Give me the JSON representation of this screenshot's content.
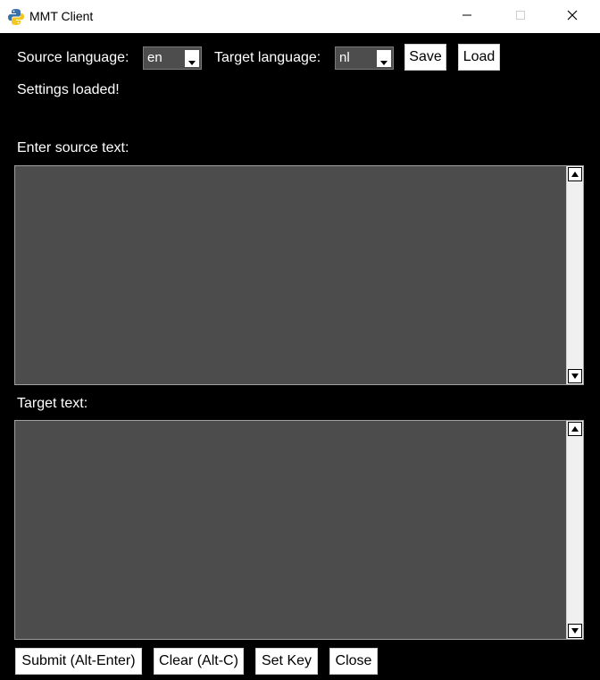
{
  "window": {
    "title": "MMT Client"
  },
  "settings": {
    "source_language_label": "Source language:",
    "source_language_value": "en",
    "target_language_label": "Target language:",
    "target_language_value": "nl",
    "save_label": "Save",
    "load_label": "Load",
    "status_text": "Settings loaded!"
  },
  "source": {
    "label": "Enter source text:",
    "text": ""
  },
  "target": {
    "label": "Target text:",
    "text": ""
  },
  "actions": {
    "submit_label": "Submit (Alt-Enter)",
    "clear_label": "Clear (Alt-C)",
    "set_key_label": "Set Key",
    "close_label": "Close"
  },
  "icons": {
    "app": "python-icon",
    "minimize": "minimize-icon",
    "maximize": "maximize-icon",
    "close": "close-icon",
    "dropdown": "dropdown-arrow-icon",
    "scroll_up": "scroll-up-arrow-icon",
    "scroll_down": "scroll-down-arrow-icon"
  },
  "colors": {
    "window_bg": "#000000",
    "text_area_bg": "#4c4c4c",
    "combo_bg": "#4d4d4d"
  }
}
